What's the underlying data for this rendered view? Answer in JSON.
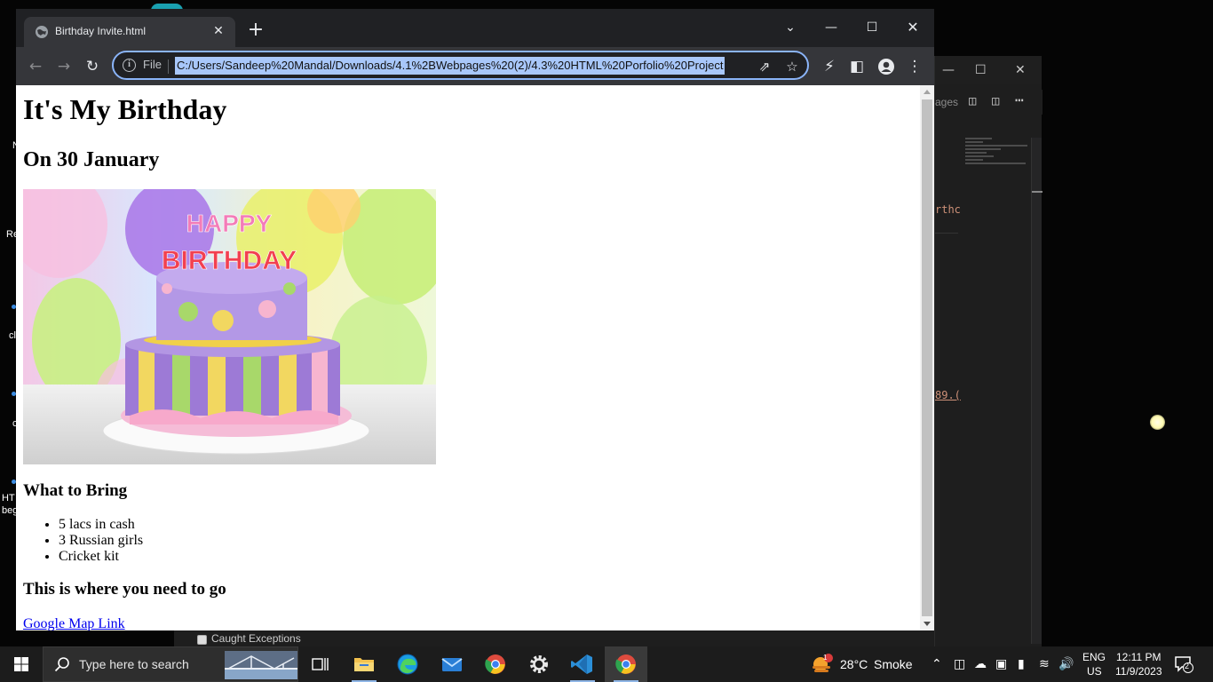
{
  "browser": {
    "tab_title": "Birthday Invite.html",
    "address_chip": "File",
    "url": "C:/Users/Sandeep%20Mandal/Downloads/4.1%2BWebpages%20(2)/4.3%20HTML%20Porfolio%20Project"
  },
  "page": {
    "heading": "It's My Birthday",
    "date_heading": "On 30 January",
    "bring_heading": "What to Bring",
    "bring_items": [
      "5 lacs in cash",
      "3 Russian girls",
      "Cricket kit"
    ],
    "where_heading": "This is where you need to go",
    "map_link": "Google Map Link",
    "cake_text_top": "HAPPY",
    "cake_text_bottom": "BIRTHDAY"
  },
  "background_window": {
    "tab_fragment": "ages",
    "code_fragment_1": "rthc",
    "code_fragment_2": "89.("
  },
  "debug_panel": {
    "caught_exceptions_label": "Caught Exceptions"
  },
  "desktop_fragments": {
    "f1": "N",
    "f2": "Re",
    "f3": "cl",
    "f4": "c",
    "f5": "HT",
    "f6": "beg"
  },
  "taskbar": {
    "search_placeholder": "Type here to search",
    "weather_temp": "28°C",
    "weather_desc": "Smoke",
    "weather_badge": "1",
    "lang_primary": "ENG",
    "lang_secondary": "US",
    "time": "12:11 PM",
    "date": "11/9/2023",
    "notification_count": "2"
  },
  "colors": {
    "chrome_dark": "#202124",
    "toolbar": "#35363a",
    "omnibox_focus": "#8ab4f8",
    "url_selection": "#a8c7fa",
    "link": "#0000ee",
    "taskbar": "#1c1c1c"
  }
}
